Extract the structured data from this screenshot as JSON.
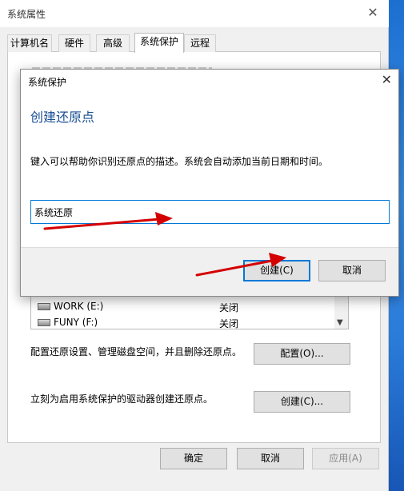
{
  "window": {
    "title": "系统属性",
    "close_glyph": "✕"
  },
  "tabs": [
    {
      "label": "计算机名"
    },
    {
      "label": "硬件"
    },
    {
      "label": "高级"
    },
    {
      "label": "系统保护",
      "active": true
    },
    {
      "label": "远程"
    }
  ],
  "drives": [
    {
      "name": "WORK (E:)",
      "status": "关闭"
    },
    {
      "name": "FUNY (F:)",
      "status": "关闭"
    }
  ],
  "configure": {
    "text": "配置还原设置、管理磁盘空间，并且删除还原点。",
    "button": "配置(O)..."
  },
  "create": {
    "text": "立刻为启用系统保护的驱动器创建还原点。",
    "button": "创建(C)..."
  },
  "footer_buttons": {
    "ok": "确定",
    "cancel": "取消",
    "apply": "应用(A)"
  },
  "dialog": {
    "title": "系统保护",
    "close_glyph": "✕",
    "heading": "创建还原点",
    "info": "键入可以帮助你识别还原点的描述。系统会自动添加当前日期和时间。",
    "input_value": "系统还原",
    "create_button": "创建(C)",
    "cancel_button": "取消"
  },
  "colors": {
    "accent": "#0078d7",
    "heading": "#1a4f94",
    "annotation_arrow": "#d40000"
  },
  "icons": {
    "drive": "hard-drive-icon",
    "scroll_down": "chevron-down-icon"
  }
}
